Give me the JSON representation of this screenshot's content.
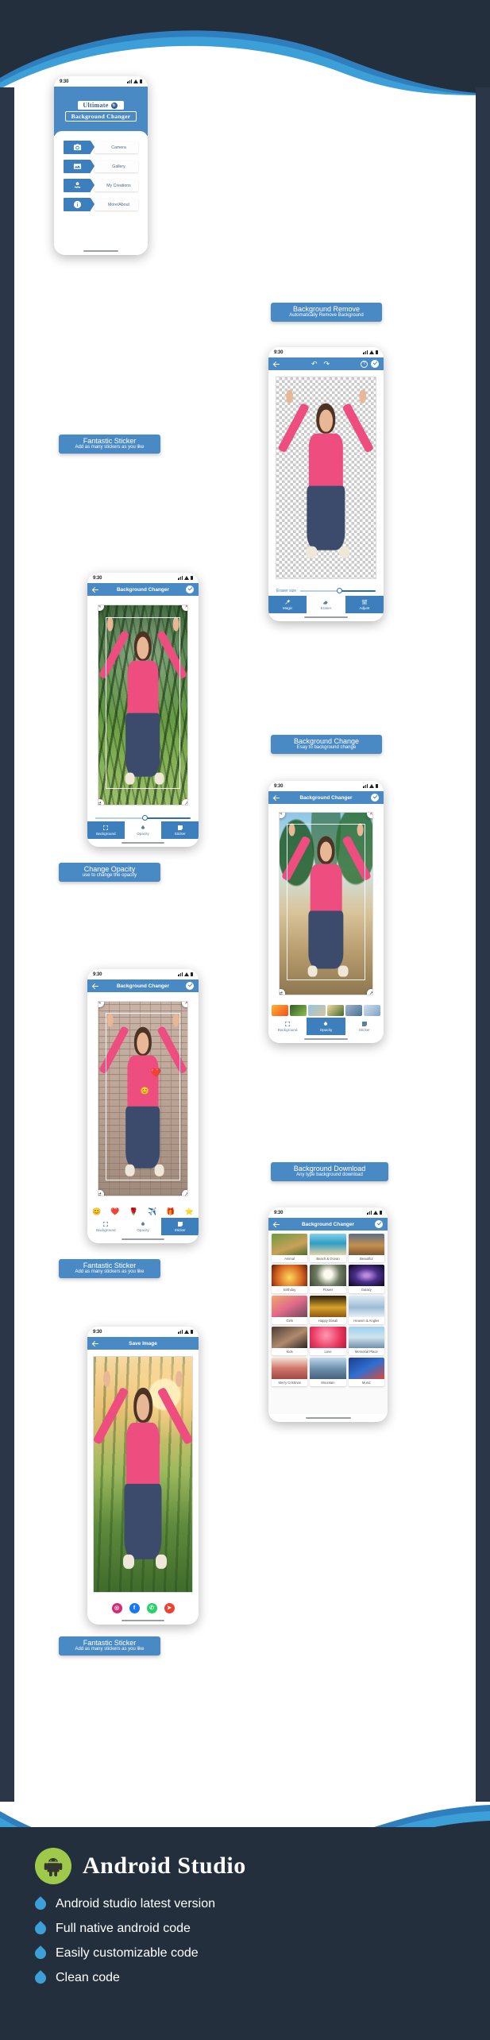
{
  "theme": {
    "navy": "#242f3e",
    "blue": "#4a8ac4",
    "blue_dark": "#3d7fbc",
    "wave_light": "#3d9fd8",
    "white": "#ffffff"
  },
  "status_bar": {
    "clock": "9:30"
  },
  "phones": {
    "splash": {
      "logo_line1": "Ultimate",
      "logo_badge": "↻",
      "logo_line2": "Background Changer",
      "menu": [
        {
          "icon": "camera-icon",
          "label": "Camera"
        },
        {
          "icon": "gallery-icon",
          "label": "Gallery"
        },
        {
          "icon": "my-creations-icon",
          "label": "My Creations"
        },
        {
          "icon": "info-icon",
          "label": "More/About"
        }
      ]
    },
    "eraser": {
      "back": "back-arrow-icon",
      "undo": "undo-icon",
      "redo": "redo-icon",
      "help": "?",
      "confirm": "check-icon",
      "slider_label": "Eraser size",
      "tabs": [
        {
          "label": "Magic",
          "icon": "magic-wand-icon",
          "active": true
        },
        {
          "label": "Eraser",
          "icon": "eraser-icon",
          "active": false
        },
        {
          "label": "Adjust",
          "icon": "adjust-sliders-icon",
          "active": true
        }
      ]
    },
    "opacity": {
      "title": "Background Changer",
      "tabs": [
        {
          "label": "Background",
          "icon": "background-icon",
          "active": true
        },
        {
          "label": "Opacity",
          "icon": "opacity-icon",
          "active": false
        },
        {
          "label": "Sticker",
          "icon": "sticker-icon",
          "active": true
        }
      ]
    },
    "bg_change": {
      "title": "Background Changer",
      "tabs": [
        {
          "label": "Background",
          "icon": "background-icon",
          "active": false
        },
        {
          "label": "Opacity",
          "icon": "opacity-icon",
          "active": true
        },
        {
          "label": "Sticker",
          "icon": "sticker-icon",
          "active": false
        }
      ]
    },
    "sticker": {
      "title": "Background Changer",
      "stickers": [
        "😊",
        "❤️",
        "🌹",
        "✈️",
        "🎁",
        "⭐"
      ],
      "tabs": [
        {
          "label": "Background",
          "icon": "background-icon",
          "active": false
        },
        {
          "label": "Opacity",
          "icon": "opacity-icon",
          "active": false
        },
        {
          "label": "Sticker",
          "icon": "sticker-icon",
          "active": true
        }
      ]
    },
    "download": {
      "title": "Background Changer",
      "categories": [
        "Animal",
        "Beach & Ocean",
        "Beautiful",
        "Birthday",
        "Flower",
        "Galaxy",
        "Girls",
        "Happy Diwali",
        "Heaven & Angles",
        "Kids",
        "Love",
        "Memorial Place",
        "Merry Cristmas",
        "Mountain",
        "Music"
      ]
    },
    "save": {
      "title": "Save Image",
      "share": [
        {
          "name": "instagram-icon",
          "glyph": "◎",
          "color": "#d62976"
        },
        {
          "name": "facebook-icon",
          "glyph": "f",
          "color": "#1877f2"
        },
        {
          "name": "whatsapp-icon",
          "glyph": "✆",
          "color": "#25d366"
        },
        {
          "name": "share-icon",
          "glyph": "➤",
          "color": "#ea4335"
        }
      ]
    }
  },
  "captions": [
    {
      "title": "Background Remove",
      "subtitle": "Automatically Remove Background"
    },
    {
      "title": "Fantastic Sticker",
      "subtitle": "Add as many stickers as you like"
    },
    {
      "title": "Background Change",
      "subtitle": "Esay to background change"
    },
    {
      "title": "Change Opacity",
      "subtitle": "use to change the opacity"
    },
    {
      "title": "Fantastic Sticker",
      "subtitle": "Add as many stickers as you like"
    },
    {
      "title": "Background Download",
      "subtitle": "Any type background download"
    },
    {
      "title": "Fantastic Sticker",
      "subtitle": "Add as many stickers as you like"
    }
  ],
  "footer": {
    "title": "Android Studio",
    "logo": "android-robot-icon",
    "features": [
      "Android studio latest version",
      "Full native android code",
      "Easily customizable code",
      "Clean code"
    ]
  }
}
